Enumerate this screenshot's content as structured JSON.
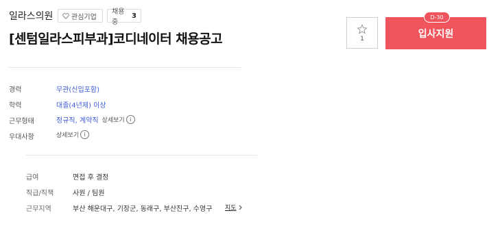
{
  "company": {
    "name": "일라스의원"
  },
  "favorite": {
    "label": "관심기업"
  },
  "hiring": {
    "label": "채용중",
    "count": "3"
  },
  "job": {
    "title": "[센텀일라스피부과]코디네이터 채용공고"
  },
  "info": {
    "career_label": "경력",
    "career_value": "무관(신입포함)",
    "education_label": "학력",
    "education_value": "대졸(4년제) 이상",
    "worktype_label": "근무형태",
    "worktype_value": "정규직, 계약직",
    "worktype_detail": "상세보기",
    "benefits_label": "우대사항",
    "benefits_detail": "상세보기"
  },
  "details": {
    "salary_label": "급여",
    "salary_value": "면접 후 결정",
    "position_label": "직급/직책",
    "position_value": "사원 / 팀원",
    "location_label": "근무지역",
    "location_value": "부산 해운대구, 기장군, 동래구, 부산진구, 수영구",
    "map_label": "지도"
  },
  "actions": {
    "scrap_count": "1",
    "apply_label": "입사지원",
    "dday_label": "D-30"
  },
  "colors": {
    "accent": "#f0545c",
    "link": "#3d5bd9"
  },
  "icons": {
    "heart": "heart-icon",
    "star": "star-icon",
    "info": "info-icon",
    "chevron": "chevron-right-icon"
  }
}
